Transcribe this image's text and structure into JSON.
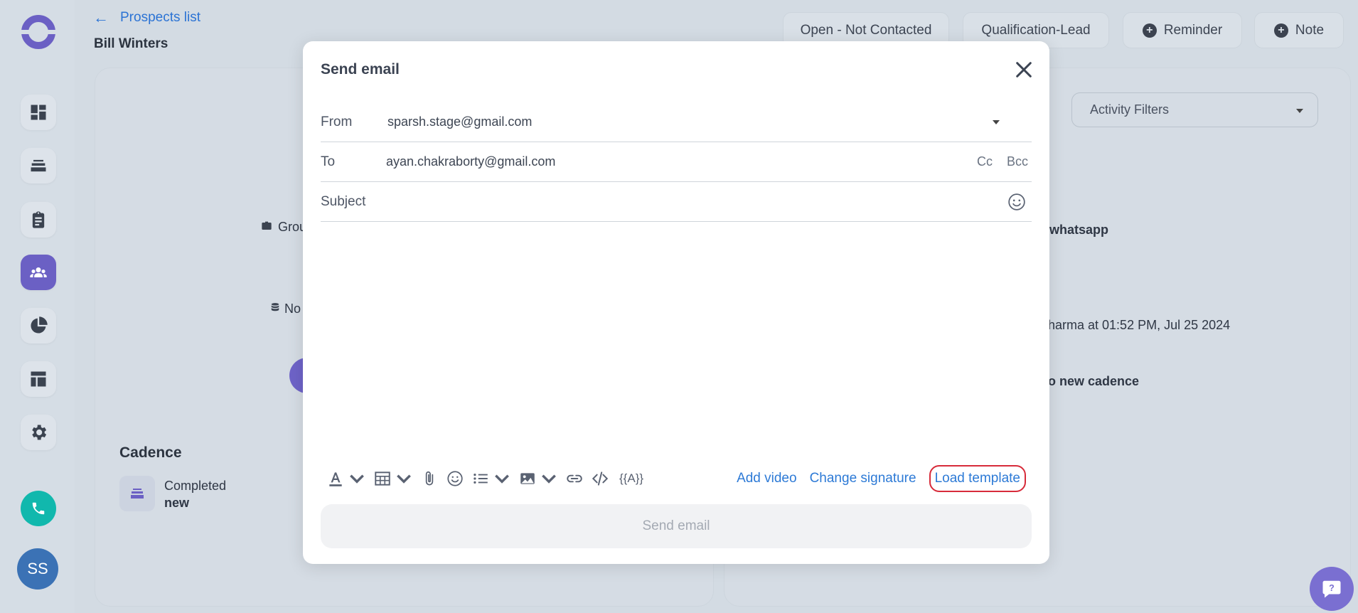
{
  "header": {
    "back_label": "Prospects list",
    "prospect_name": "Bill Winters",
    "status_button": "Open - Not Contacted",
    "stage_button": "Qualification-Lead",
    "reminder_button": "Reminder",
    "note_button": "Note"
  },
  "sidebar": {
    "avatar_initials": "SS",
    "items": [
      "dashboard-icon",
      "cadence-icon",
      "tasks-icon",
      "people-icon",
      "reports-icon",
      "templates-icon",
      "settings-icon"
    ],
    "active_item": "people-icon"
  },
  "background": {
    "group_fragment": "Grou",
    "notes_fragment": "No",
    "activity_filter_label": "Activity Filters",
    "activity_whatsapp": "whatsapp",
    "activity_time": "harma at 01:52 PM, Jul 25 2024",
    "activity_cadence": "o new cadence",
    "cadence_title": "Cadence",
    "cadence_status": "Completed",
    "cadence_name": "new"
  },
  "modal": {
    "title": "Send email",
    "from_label": "From",
    "from_value": "sparsh.stage@gmail.com",
    "to_label": "To",
    "to_value": "ayan.chakraborty@gmail.com",
    "cc_label": "Cc",
    "bcc_label": "Bcc",
    "subject_label": "Subject",
    "subject_value": "",
    "body_value": "",
    "variable_token": "{{A}}",
    "add_video_label": "Add video",
    "change_signature_label": "Change signature",
    "load_template_label": "Load template",
    "send_label": "Send email"
  },
  "colors": {
    "accent": "#6b60c4",
    "link": "#2d7ad6",
    "highlight_border": "#d72b3a",
    "call": "#11b8ad"
  }
}
